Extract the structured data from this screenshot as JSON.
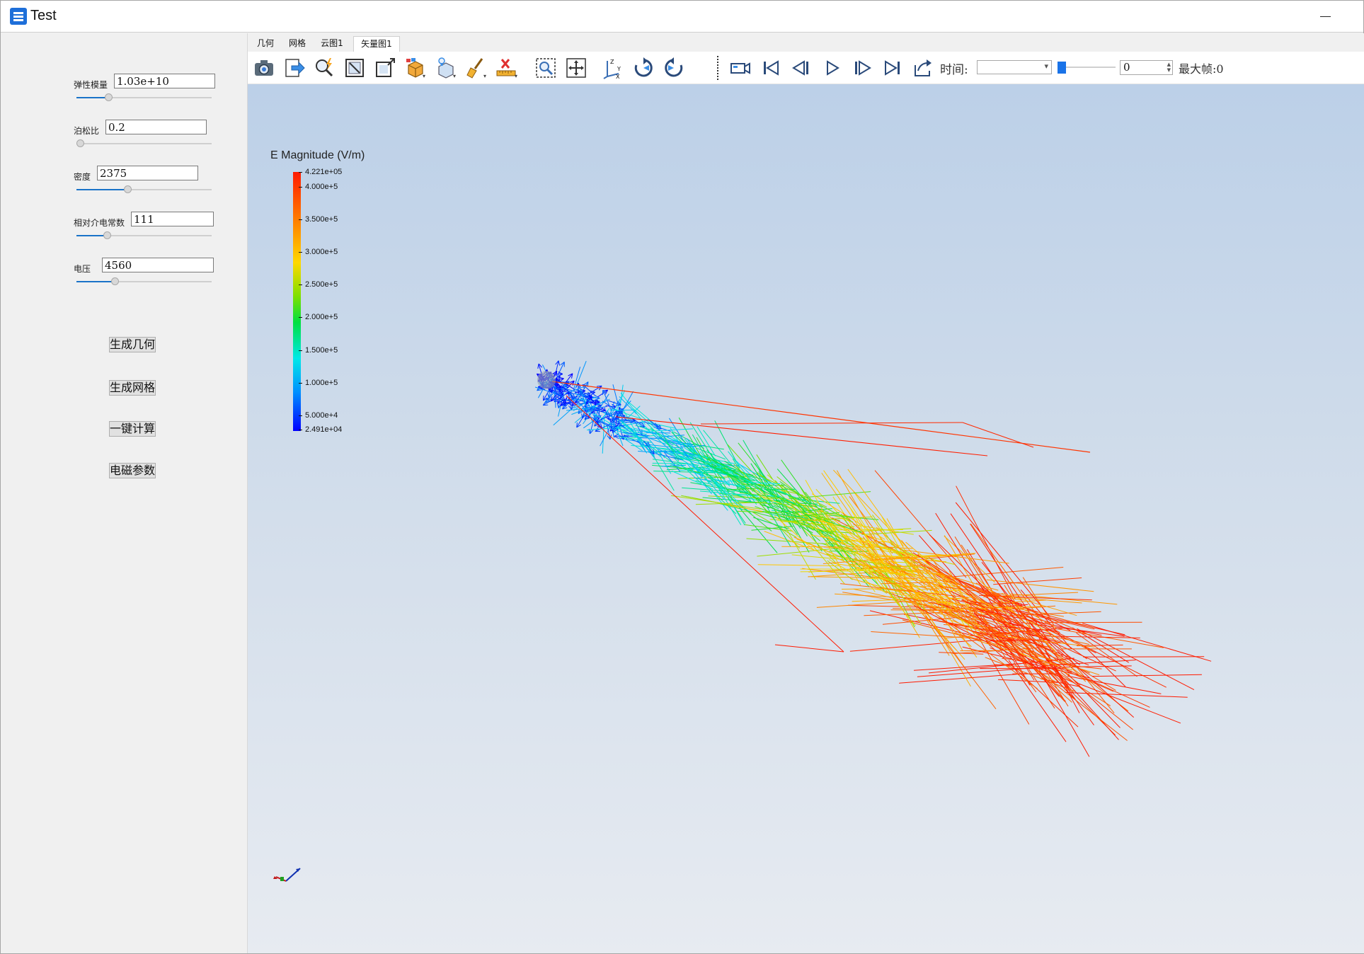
{
  "window": {
    "title": "Test"
  },
  "parameters": [
    {
      "label": "弹性模量",
      "value": "1.03e+10",
      "slider_fraction": 0.22
    },
    {
      "label": "泊松比",
      "value": "0.2",
      "slider_fraction": 0.0
    },
    {
      "label": "密度",
      "value": "2375",
      "slider_fraction": 0.37
    },
    {
      "label": "相对介电常数",
      "value": "111",
      "slider_fraction": 0.21
    },
    {
      "label": "电压",
      "value": "4560",
      "slider_fraction": 0.27
    }
  ],
  "buttons": [
    {
      "label": "生成几何"
    },
    {
      "label": "生成网格"
    },
    {
      "label": "一键计算"
    },
    {
      "label": "电磁参数"
    }
  ],
  "tabs": [
    {
      "label": "几何",
      "active": false
    },
    {
      "label": "网格",
      "active": false
    },
    {
      "label": "云图1",
      "active": false
    },
    {
      "label": "矢量图1",
      "active": true
    }
  ],
  "toolbar": {
    "icons": [
      "camera-icon",
      "export-icon",
      "zoom-lightning-icon",
      "fit-box-icon",
      "resize-box-icon",
      "cube-color-icon",
      "cube-light-icon",
      "broom-icon",
      "ruler-delete-icon",
      "zoom-region-icon",
      "pan-icon",
      "axes-xyz-icon",
      "rotate-cw-icon",
      "rotate-ccw-icon",
      "video-camera-icon",
      "first-frame-icon",
      "prev-frame-icon",
      "play-icon",
      "next-frame-icon",
      "last-frame-icon",
      "export-animation-icon"
    ],
    "time_label": "时间:",
    "time_value": "",
    "frame_value": "0",
    "frame_slider_fraction": 0.0,
    "max_frame_label": "最大帧:0"
  },
  "colorbar": {
    "title": "E Magnitude (V/m)",
    "ticks": [
      "4.221e+05",
      "4.000e+5",
      "3.500e+5",
      "3.000e+5",
      "2.500e+5",
      "2.000e+5",
      "1.500e+5",
      "1.000e+5",
      "5.000e+4",
      "2.491e+04"
    ]
  },
  "colors": {
    "accent": "#1a73e8",
    "viewport_top": "#bcd0e8",
    "viewport_bottom": "#e7ebf1"
  }
}
